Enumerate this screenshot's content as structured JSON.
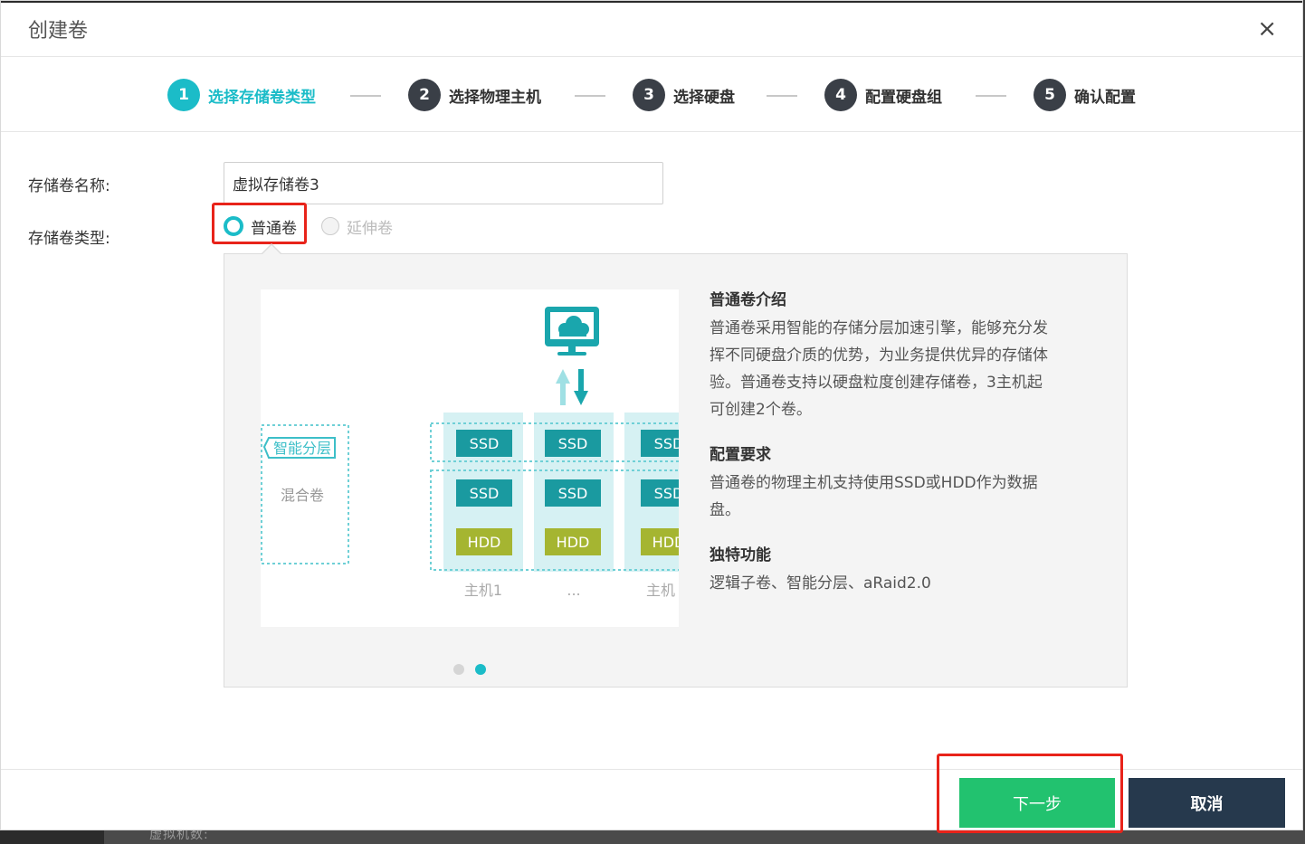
{
  "backdrop": {
    "partial_text": "虚拟机数:"
  },
  "dialog": {
    "title": "创建卷",
    "close_glyph": "×"
  },
  "steps": [
    {
      "num": "1",
      "label": "选择存储卷类型",
      "active": true
    },
    {
      "num": "2",
      "label": "选择物理主机",
      "active": false
    },
    {
      "num": "3",
      "label": "选择硬盘",
      "active": false
    },
    {
      "num": "4",
      "label": "配置硬盘组",
      "active": false
    },
    {
      "num": "5",
      "label": "确认配置",
      "active": false
    }
  ],
  "form": {
    "name_label": "存储卷名称:",
    "name_value": "虚拟存储卷3",
    "type_label": "存储卷类型:",
    "type_options": [
      {
        "label": "普通卷",
        "selected": true,
        "enabled": true
      },
      {
        "label": "延伸卷",
        "selected": false,
        "enabled": false
      }
    ]
  },
  "illustration": {
    "tier_label": "智能分层",
    "volume_label": "混合卷",
    "disk_labels": [
      "SSD",
      "SSD",
      "SSD",
      "SSD",
      "SSD",
      "SSD",
      "HDD",
      "HDD",
      "HDD"
    ],
    "host_labels": [
      "主机1",
      "...",
      "主机"
    ]
  },
  "intro": {
    "sections": [
      {
        "title": "普通卷介绍",
        "body": "普通卷采用智能的存储分层加速引擎，能够充分发挥不同硬盘介质的优势，为业务提供优异的存储体验。普通卷支持以硬盘粒度创建存储卷，3主机起可创建2个卷。"
      },
      {
        "title": "配置要求",
        "body": "普通卷的物理主机支持使用SSD或HDD作为数据盘。"
      },
      {
        "title": "独特功能",
        "body": "逻辑子卷、智能分层、aRaid2.0"
      }
    ],
    "carousel": {
      "count": 2,
      "active_index": 1
    }
  },
  "footer": {
    "next_label": "下一步",
    "cancel_label": "取消"
  },
  "colors": {
    "accent": "#1bbcc8",
    "step_inactive": "#3a3f47",
    "next_button": "#22c26f",
    "cancel_button": "#26394d",
    "highlight_box": "#e8231a",
    "ssd": "#1a9aa0",
    "hdd": "#a5b531"
  },
  "icons": [
    "close-icon",
    "cloud-monitor-icon",
    "transfer-arrows-icon"
  ]
}
